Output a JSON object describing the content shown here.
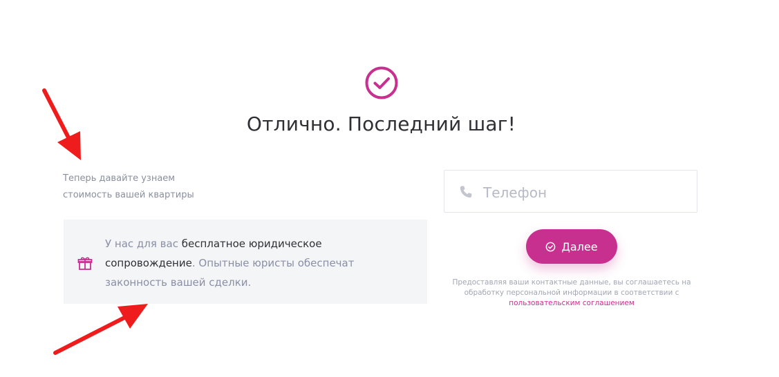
{
  "header": {
    "title": "Отлично. Последний шаг!"
  },
  "intro": {
    "line1": "Теперь давайте узнаем",
    "line2": "стоимость вашей квартиры"
  },
  "gift_note": {
    "part1": "У нас для вас ",
    "part2": "бесплатное юридическое сопровождение",
    "part3": ". Опытные юристы обеспечат законность вашей сделки."
  },
  "form": {
    "phone_placeholder": "Телефон",
    "phone_value": "",
    "submit_label": "Далее",
    "consent_text": "Предоставляя ваши контактные данные, вы соглашаетесь на обработку персональной информации в соответствии с ",
    "consent_link": "пользовательским соглашением"
  },
  "icons": {
    "success": "check-circle-icon",
    "gift": "gift-icon",
    "phone": "phone-icon",
    "button": "check-circle-icon"
  },
  "colors": {
    "accent": "#c8308f",
    "annotation_arrow": "#ee1c1c",
    "muted_text": "#8a8fa6",
    "heading_text": "#2f2f35"
  }
}
